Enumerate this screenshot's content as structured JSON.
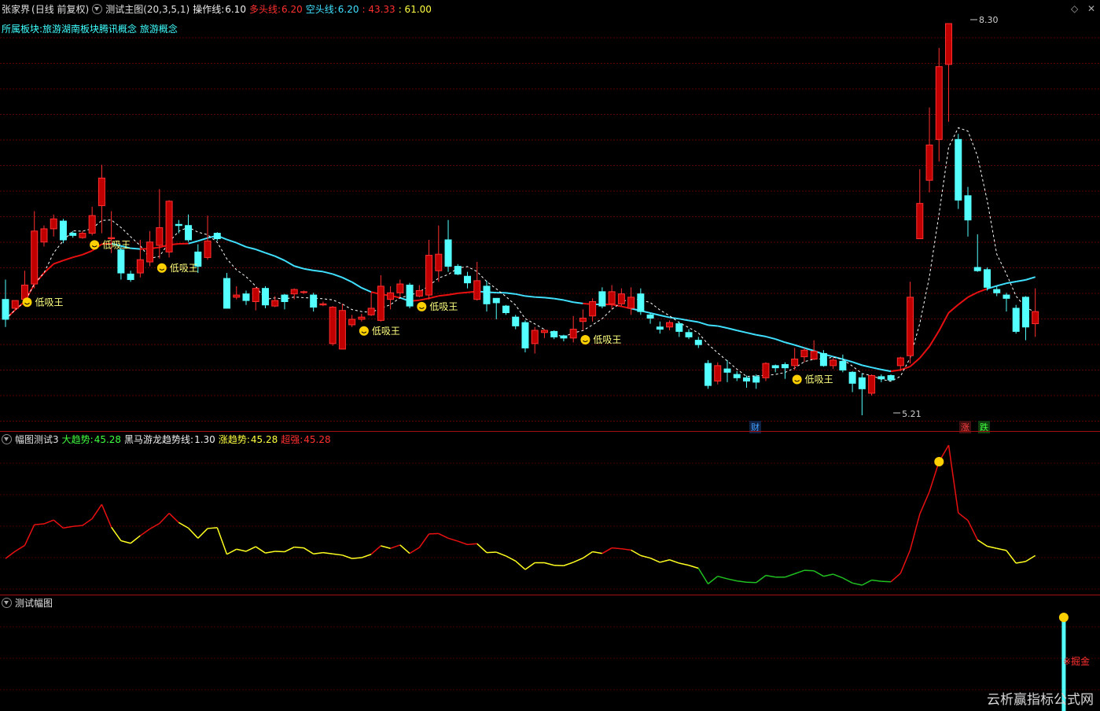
{
  "header": {
    "stock": "张家界",
    "period": "(日线 前复权)",
    "indicator": "测试主图(20,3,5,1)",
    "op_label": "操作线:",
    "op_value": "6.10",
    "bull_label": "多头线:",
    "bull_value": "6.20",
    "bear_label": "空头线:",
    "bear_value": "6.20",
    "v1": ": 43.33",
    "v2": ": 61.00",
    "sector_label": "所属板块:",
    "sectors": "旅游湖南板块腾讯概念 旅游概念"
  },
  "main": {
    "signal_label": "低吸王",
    "high_label": "8.30",
    "low_label": "5.21",
    "marker_cai": "财",
    "marker_zhang": "涨",
    "marker_die": "跌"
  },
  "sub1": {
    "name": "幅图测试3",
    "l1": "大趋势:",
    "v1": "45.28",
    "l2": "黑马游龙趋势线:",
    "v2": "1.30",
    "l3": "涨趋势:",
    "v3": "45.28",
    "l4": "超强:",
    "v4": "45.28"
  },
  "sub2": {
    "name": "测试幅图",
    "signal": "※掘金"
  },
  "watermark": "云析赢指标公式网",
  "colors": {
    "up": "#ff3030",
    "down": "#54ffff",
    "ma": "#40e0ff",
    "red": "#e81010",
    "yellow": "#ffff20",
    "green": "#20c020"
  },
  "chart_data": {
    "type": "candlestick",
    "ylim": [
      5.0,
      8.5
    ],
    "candles": [
      [
        5.8,
        5.62,
        5.98,
        5.55
      ],
      [
        5.72,
        5.79,
        5.78,
        5.7
      ],
      [
        5.8,
        5.93,
        6.06,
        5.86
      ],
      [
        5.94,
        6.42,
        6.6,
        5.9
      ],
      [
        6.32,
        6.44,
        6.47,
        6.28
      ],
      [
        6.44,
        6.53,
        6.57,
        6.37
      ],
      [
        6.51,
        6.34,
        6.53,
        6.31
      ],
      [
        6.4,
        6.38,
        6.42,
        6.36
      ],
      [
        6.36,
        6.4,
        6.42,
        6.35
      ],
      [
        6.4,
        6.56,
        6.64,
        6.38
      ],
      [
        6.65,
        6.9,
        7.02,
        6.4
      ],
      [
        6.35,
        6.36,
        6.6,
        6.22
      ],
      [
        6.25,
        6.04,
        6.28,
        5.98
      ],
      [
        6.03,
        5.98,
        6.06,
        5.96
      ],
      [
        6.04,
        6.16,
        6.34,
        6.0
      ],
      [
        6.14,
        6.32,
        6.42,
        6.1
      ],
      [
        6.29,
        6.45,
        6.8,
        6.17
      ],
      [
        6.23,
        6.69,
        6.7,
        6.18
      ],
      [
        6.48,
        6.47,
        6.52,
        6.4
      ],
      [
        6.47,
        6.34,
        6.57,
        6.32
      ],
      [
        6.23,
        6.1,
        6.3,
        6.04
      ],
      [
        6.18,
        6.33,
        6.56,
        6.16
      ],
      [
        6.4,
        6.35,
        6.41,
        6.33
      ],
      [
        5.99,
        5.72,
        6.04,
        5.74
      ],
      [
        5.82,
        5.84,
        5.92,
        5.8
      ],
      [
        5.85,
        5.79,
        5.88,
        5.75
      ],
      [
        5.78,
        5.9,
        5.91,
        5.7
      ],
      [
        5.9,
        5.75,
        5.92,
        5.72
      ],
      [
        5.74,
        5.79,
        5.83,
        5.73
      ],
      [
        5.84,
        5.78,
        5.85,
        5.71
      ],
      [
        5.85,
        5.89,
        5.9,
        5.8
      ],
      [
        5.87,
        5.87,
        5.88,
        5.85
      ],
      [
        5.84,
        5.73,
        5.86,
        5.69
      ],
      [
        5.75,
        5.76,
        5.78,
        5.74
      ],
      [
        5.4,
        5.73,
        5.74,
        5.38
      ],
      [
        5.35,
        5.7,
        5.76,
        5.35
      ],
      [
        5.57,
        5.62,
        5.66,
        5.55
      ],
      [
        5.62,
        5.64,
        5.67,
        5.6
      ],
      [
        5.66,
        5.72,
        5.86,
        5.65
      ],
      [
        5.61,
        5.92,
        6.02,
        5.6
      ],
      [
        5.8,
        5.86,
        5.92,
        5.71
      ],
      [
        5.86,
        5.94,
        5.98,
        5.82
      ],
      [
        5.93,
        5.74,
        5.95,
        5.72
      ],
      [
        5.83,
        5.88,
        5.93,
        5.82
      ],
      [
        5.84,
        6.2,
        6.34,
        5.8
      ],
      [
        6.06,
        6.21,
        6.47,
        5.96
      ],
      [
        6.34,
        6.1,
        6.52,
        6.05
      ],
      [
        6.1,
        6.03,
        6.12,
        6.02
      ],
      [
        6.01,
        5.95,
        6.05,
        5.9
      ],
      [
        5.8,
        5.97,
        6.14,
        5.79
      ],
      [
        5.92,
        5.76,
        5.97,
        5.69
      ],
      [
        5.81,
        5.77,
        5.81,
        5.62
      ],
      [
        5.74,
        5.68,
        5.75,
        5.66
      ],
      [
        5.64,
        5.56,
        5.66,
        5.53
      ],
      [
        5.59,
        5.36,
        5.61,
        5.32
      ],
      [
        5.4,
        5.52,
        5.55,
        5.31
      ],
      [
        5.5,
        5.52,
        5.53,
        5.45
      ],
      [
        5.51,
        5.46,
        5.52,
        5.44
      ],
      [
        5.47,
        5.45,
        5.48,
        5.42
      ],
      [
        5.45,
        5.53,
        5.65,
        5.41
      ],
      [
        5.6,
        5.63,
        5.71,
        5.52
      ],
      [
        5.65,
        5.78,
        5.81,
        5.6
      ],
      [
        5.87,
        5.74,
        5.91,
        5.72
      ],
      [
        5.76,
        5.87,
        5.93,
        5.71
      ],
      [
        5.76,
        5.85,
        5.9,
        5.74
      ],
      [
        5.72,
        5.82,
        5.91,
        5.66
      ],
      [
        5.85,
        5.69,
        5.9,
        5.66
      ],
      [
        5.66,
        5.63,
        5.68,
        5.58
      ],
      [
        5.55,
        5.53,
        5.6,
        5.49
      ],
      [
        5.55,
        5.59,
        5.61,
        5.52
      ],
      [
        5.58,
        5.51,
        5.6,
        5.46
      ],
      [
        5.5,
        5.46,
        5.53,
        5.44
      ],
      [
        5.43,
        5.39,
        5.46,
        5.36
      ],
      [
        5.22,
        5.02,
        5.25,
        4.99
      ],
      [
        5.06,
        5.2,
        5.23,
        5.03
      ],
      [
        5.17,
        5.14,
        5.25,
        5.05
      ],
      [
        5.12,
        5.09,
        5.15,
        5.06
      ],
      [
        5.09,
        5.06,
        5.11,
        5.0
      ],
      [
        5.1,
        5.05,
        5.12,
        4.99
      ],
      [
        5.09,
        5.22,
        5.23,
        5.06
      ],
      [
        5.2,
        5.18,
        5.21,
        5.14
      ],
      [
        5.21,
        5.18,
        5.23,
        5.08
      ],
      [
        5.2,
        5.26,
        5.36,
        5.16
      ],
      [
        5.28,
        5.34,
        5.36,
        5.23
      ],
      [
        5.26,
        5.33,
        5.43,
        5.25
      ],
      [
        5.31,
        5.2,
        5.34,
        5.19
      ],
      [
        5.2,
        5.25,
        5.27,
        5.17
      ],
      [
        5.24,
        5.16,
        5.3,
        5.14
      ],
      [
        5.14,
        5.04,
        5.15,
        4.96
      ],
      [
        5.09,
        4.99,
        5.13,
        4.75
      ],
      [
        4.95,
        5.11,
        5.12,
        4.93
      ],
      [
        5.1,
        5.08,
        5.12,
        5.05
      ],
      [
        5.11,
        5.07,
        5.12,
        5.06
      ],
      [
        5.2,
        5.27,
        5.28,
        5.15
      ],
      [
        5.29,
        5.82,
        5.96,
        5.22
      ],
      [
        6.35,
        6.67,
        6.98,
        6.36
      ],
      [
        6.88,
        7.2,
        7.54,
        6.77
      ],
      [
        7.25,
        7.91,
        8.08,
        7.05
      ],
      [
        7.93,
        8.3,
        8.3,
        7.41
      ],
      [
        7.25,
        6.7,
        7.3,
        6.62
      ],
      [
        6.74,
        6.52,
        6.82,
        6.37
      ],
      [
        6.09,
        6.06,
        6.39,
        6.05
      ],
      [
        6.07,
        5.91,
        6.09,
        5.88
      ],
      [
        5.89,
        5.86,
        5.92,
        5.83
      ],
      [
        5.84,
        5.81,
        5.86,
        5.69
      ],
      [
        5.72,
        5.51,
        5.75,
        5.49
      ],
      [
        5.82,
        5.55,
        5.83,
        5.43
      ],
      [
        5.58,
        5.69,
        5.9,
        5.46
      ]
    ]
  }
}
